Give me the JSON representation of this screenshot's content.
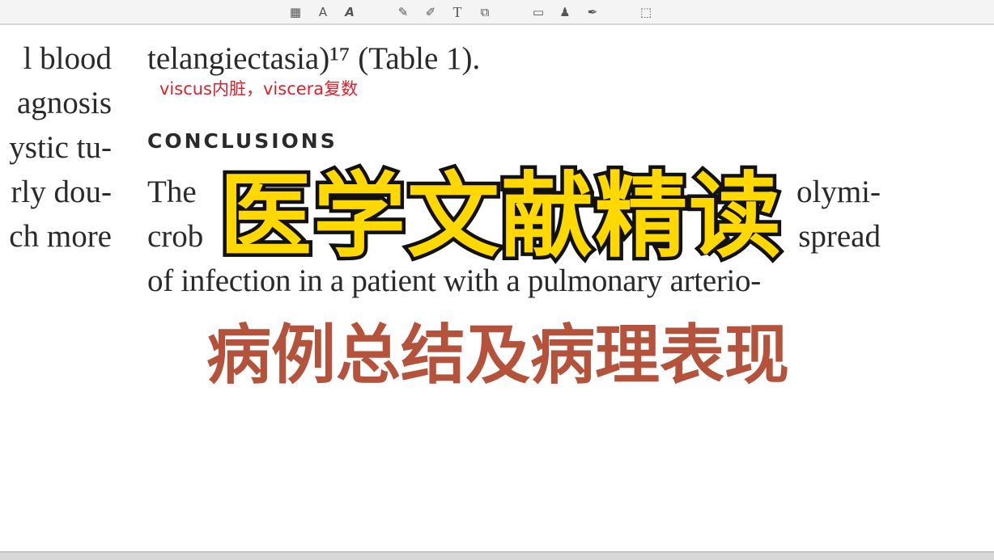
{
  "toolbar": {
    "icons": [
      "text-style-icon",
      "font-a-icon",
      "font-a-outline-icon",
      "pencil-icon",
      "highlighter-icon",
      "text-tool-icon",
      "shapes-icon",
      "comment-icon",
      "stamp-icon",
      "pen-icon",
      "selection-icon"
    ],
    "text_tool_glyph": "T"
  },
  "document": {
    "left_column": [
      "l blood",
      "agnosis",
      "ystic tu-",
      "rly dou-",
      "ch more"
    ],
    "right_line_1": "telangiectasia)¹⁷ (Table 1).",
    "annotation": "viscus内脏，viscera复数",
    "heading": "CONCLUSIONS",
    "body_line_1_start": "The",
    "body_line_1_end": "olymi-",
    "body_line_2_start": "crob",
    "body_line_2_end": "spread",
    "body_line_3": "of infection in a patient with a pulmonary arterio-"
  },
  "overlay": {
    "title": "医学文献精读",
    "subtitle": "病例总结及病理表现",
    "title_color": "#ffd800",
    "subtitle_color": "#b4523b",
    "annotation_color": "#e0202a"
  }
}
